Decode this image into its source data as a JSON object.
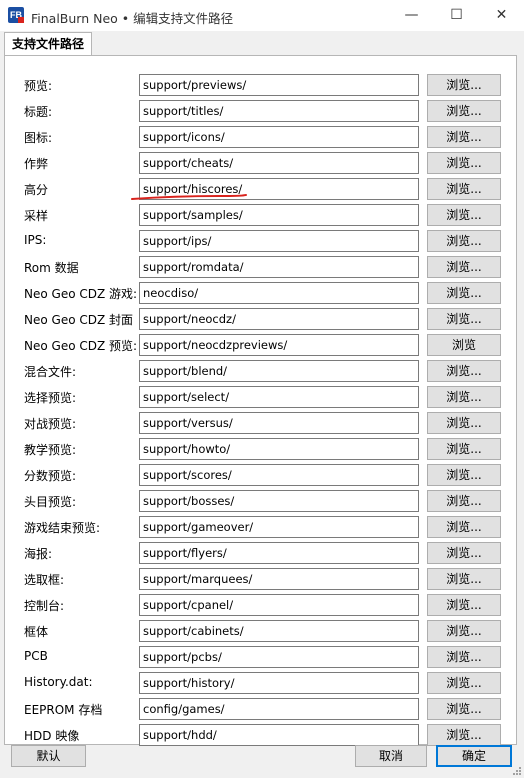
{
  "window": {
    "title": "FinalBurn Neo • 编辑支持文件路径",
    "app_icon_text": "FB",
    "minimize_glyph": "—",
    "maximize_glyph": "☐",
    "close_glyph": "✕"
  },
  "tab": {
    "label": "支持文件路径"
  },
  "rows": [
    {
      "label": "预览:",
      "path": "support/previews/",
      "button": "浏览..."
    },
    {
      "label": "标题:",
      "path": "support/titles/",
      "button": "浏览..."
    },
    {
      "label": "图标:",
      "path": "support/icons/",
      "button": "浏览..."
    },
    {
      "label": "作弊",
      "path": "support/cheats/",
      "button": "浏览..."
    },
    {
      "label": "高分",
      "path": "support/hiscores/",
      "button": "浏览..."
    },
    {
      "label": "采样",
      "path": "support/samples/",
      "button": "浏览..."
    },
    {
      "label": "IPS:",
      "path": "support/ips/",
      "button": "浏览..."
    },
    {
      "label": "Rom 数据",
      "path": "support/romdata/",
      "button": "浏览..."
    },
    {
      "label": "Neo Geo CDZ 游戏:",
      "path": "neocdiso/",
      "button": "浏览..."
    },
    {
      "label": "Neo Geo CDZ 封面",
      "path": "support/neocdz/",
      "button": "浏览..."
    },
    {
      "label": "Neo Geo CDZ 预览:",
      "path": "support/neocdzpreviews/",
      "button": "浏览"
    },
    {
      "label": "混合文件:",
      "path": "support/blend/",
      "button": "浏览..."
    },
    {
      "label": "选择预览:",
      "path": "support/select/",
      "button": "浏览..."
    },
    {
      "label": "对战预览:",
      "path": "support/versus/",
      "button": "浏览..."
    },
    {
      "label": "教学预览:",
      "path": "support/howto/",
      "button": "浏览..."
    },
    {
      "label": "分数预览:",
      "path": "support/scores/",
      "button": "浏览..."
    },
    {
      "label": "头目预览:",
      "path": "support/bosses/",
      "button": "浏览..."
    },
    {
      "label": "游戏结束预览:",
      "path": "support/gameover/",
      "button": "浏览..."
    },
    {
      "label": "海报:",
      "path": "support/flyers/",
      "button": "浏览..."
    },
    {
      "label": "选取框:",
      "path": "support/marquees/",
      "button": "浏览..."
    },
    {
      "label": "控制台:",
      "path": "support/cpanel/",
      "button": "浏览..."
    },
    {
      "label": "框体",
      "path": "support/cabinets/",
      "button": "浏览..."
    },
    {
      "label": "PCB",
      "path": "support/pcbs/",
      "button": "浏览..."
    },
    {
      "label": "History.dat:",
      "path": "support/history/",
      "button": "浏览..."
    },
    {
      "label": "EEPROM 存档",
      "path": "config/games/",
      "button": "浏览..."
    },
    {
      "label": "HDD 映像",
      "path": "support/hdd/",
      "button": "浏览..."
    }
  ],
  "annotation": {
    "color": "#d9231d"
  },
  "footer": {
    "default_label": "默认",
    "cancel_label": "取消",
    "ok_label": "确定"
  }
}
